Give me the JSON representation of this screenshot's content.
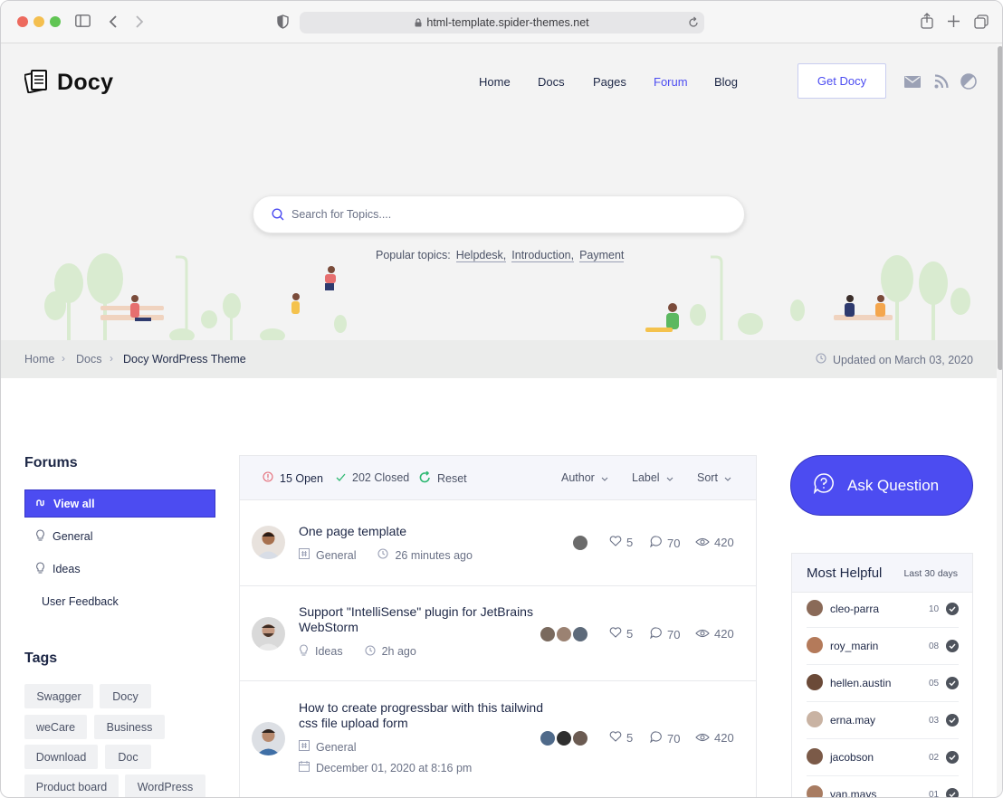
{
  "browser": {
    "url": "html-template.spider-themes.net"
  },
  "header": {
    "logo": "Docy",
    "nav": [
      "Home",
      "Docs",
      "Pages",
      "Forum",
      "Blog"
    ],
    "active_nav": "Forum",
    "cta": "Get Docy",
    "icons": [
      "mail-icon",
      "rss-icon",
      "dark-mode-icon"
    ]
  },
  "search": {
    "placeholder": "Search for Topics....",
    "popular_label": "Popular topics:",
    "popular": [
      "Helpdesk,",
      "Introduction,",
      "Payment"
    ]
  },
  "breadcrumb": {
    "items": [
      "Home",
      "Docs",
      "Docy WordPress Theme"
    ],
    "updated": "Updated on March 03, 2020"
  },
  "sidebar": {
    "forums_title": "Forums",
    "forums": [
      "View all",
      "General",
      "Ideas",
      "User Feedback"
    ],
    "tags_title": "Tags",
    "tags": [
      "Swagger",
      "Docy",
      "weCare",
      "Business",
      "Download",
      "Doc",
      "Product board",
      "WordPress"
    ]
  },
  "topics": {
    "open": "15 Open",
    "closed": "202 Closed",
    "reset": "Reset",
    "filters": [
      "Author",
      "Label",
      "Sort"
    ],
    "rows": [
      {
        "title": "One page template",
        "category": "General",
        "time": "26 minutes ago",
        "likes": "5",
        "comments": "70",
        "views": "420"
      },
      {
        "title": "Support \"IntelliSense\" plugin for JetBrains WebStorm",
        "category": "Ideas",
        "time": "2h ago",
        "likes": "5",
        "comments": "70",
        "views": "420"
      },
      {
        "title": "How to create progressbar with this tailwind css file upload form",
        "category": "General",
        "time": "December 01, 2020 at 8:16 pm",
        "likes": "5",
        "comments": "70",
        "views": "420"
      }
    ]
  },
  "ask": {
    "label": "Ask Question"
  },
  "most_helpful": {
    "title": "Most Helpful",
    "period": "Last 30 days",
    "users": [
      {
        "name": "cleo-parra",
        "count": "10"
      },
      {
        "name": "roy_marin",
        "count": "08"
      },
      {
        "name": "hellen.austin",
        "count": "05"
      },
      {
        "name": "erna.may",
        "count": "03"
      },
      {
        "name": "jacobson",
        "count": "02"
      },
      {
        "name": "van.mays",
        "count": "01"
      }
    ]
  },
  "colors": {
    "accent": "#4c4cf1",
    "text": "#1d2746",
    "muted": "#6a7186",
    "hero_bg": "#f3f3f3"
  }
}
